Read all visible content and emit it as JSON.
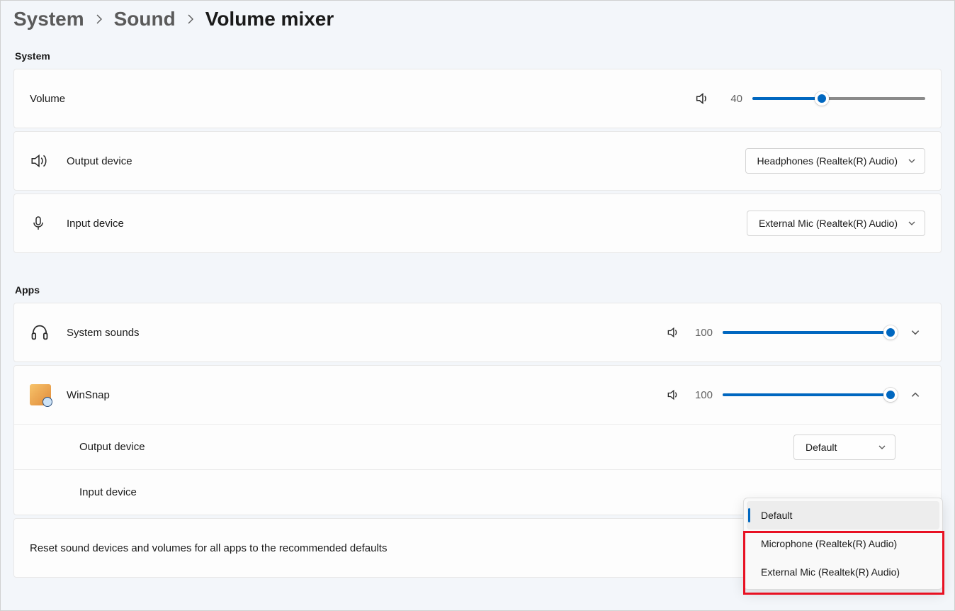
{
  "breadcrumb": {
    "system": "System",
    "sound": "Sound",
    "current": "Volume mixer"
  },
  "sections": {
    "system": "System",
    "apps": "Apps"
  },
  "systemArea": {
    "volumeLabel": "Volume",
    "volumeValue": "40",
    "volumePercent": 40,
    "outputLabel": "Output device",
    "outputValue": "Headphones (Realtek(R) Audio)",
    "inputLabel": "Input device",
    "inputValue": "External Mic (Realtek(R) Audio)"
  },
  "apps": {
    "systemSounds": {
      "label": "System sounds",
      "volumeValue": "100",
      "volumePercent": 100
    },
    "winsnap": {
      "label": "WinSnap",
      "volumeValue": "100",
      "volumePercent": 100,
      "outputLabel": "Output device",
      "outputValue": "Default",
      "inputLabel": "Input device"
    }
  },
  "inputPopup": {
    "items": [
      {
        "label": "Default",
        "selected": true
      },
      {
        "label": "Microphone (Realtek(R) Audio)",
        "selected": false
      },
      {
        "label": "External Mic (Realtek(R) Audio)",
        "selected": false
      }
    ]
  },
  "resetRow": "Reset sound devices and volumes for all apps to the recommended defaults"
}
